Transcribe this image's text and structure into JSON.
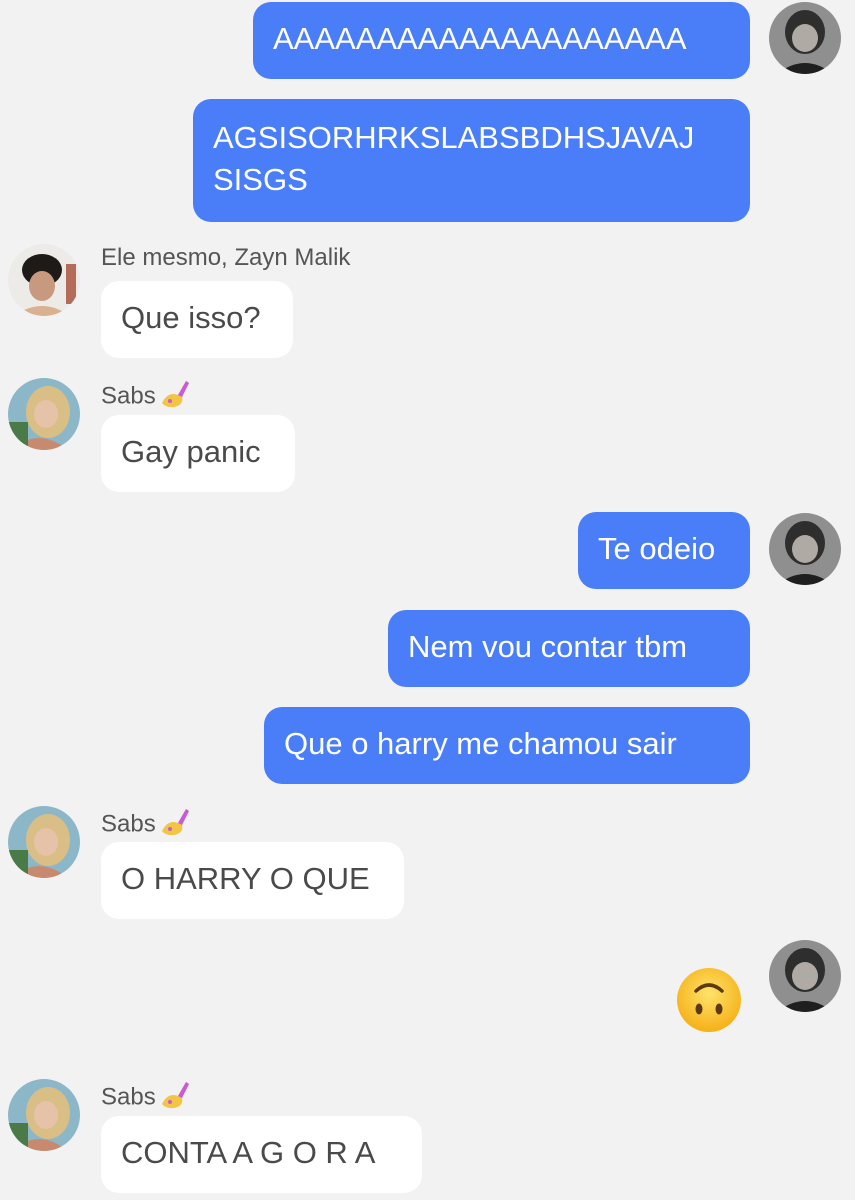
{
  "messages": [
    {
      "dir": "out",
      "text": "AAAAAAAAAAAAAAAAAAAA"
    },
    {
      "dir": "out",
      "text": "AGSISORHRKSLABSBDHSJAVAJ SISGS"
    },
    {
      "dir": "in",
      "sender": "Ele mesmo, Zayn Malik",
      "text": "Que isso?"
    },
    {
      "dir": "in",
      "sender": "Sabs",
      "sender_emoji": "nail-polish",
      "text": "Gay panic"
    },
    {
      "dir": "out",
      "text": "Te odeio"
    },
    {
      "dir": "out",
      "text": "Nem vou contar tbm"
    },
    {
      "dir": "out",
      "text": "Que o harry me chamou sair"
    },
    {
      "dir": "in",
      "sender": "Sabs",
      "sender_emoji": "nail-polish",
      "text": "O HARRY O QUE"
    },
    {
      "dir": "out",
      "emoji": "upside-down-face"
    },
    {
      "dir": "in",
      "sender": "Sabs",
      "sender_emoji": "nail-polish",
      "text": "CONTA A G O R A"
    }
  ],
  "colors": {
    "outgoing_bubble": "#4a7df8",
    "incoming_bubble": "#ffffff",
    "background": "#f2f2f2"
  }
}
